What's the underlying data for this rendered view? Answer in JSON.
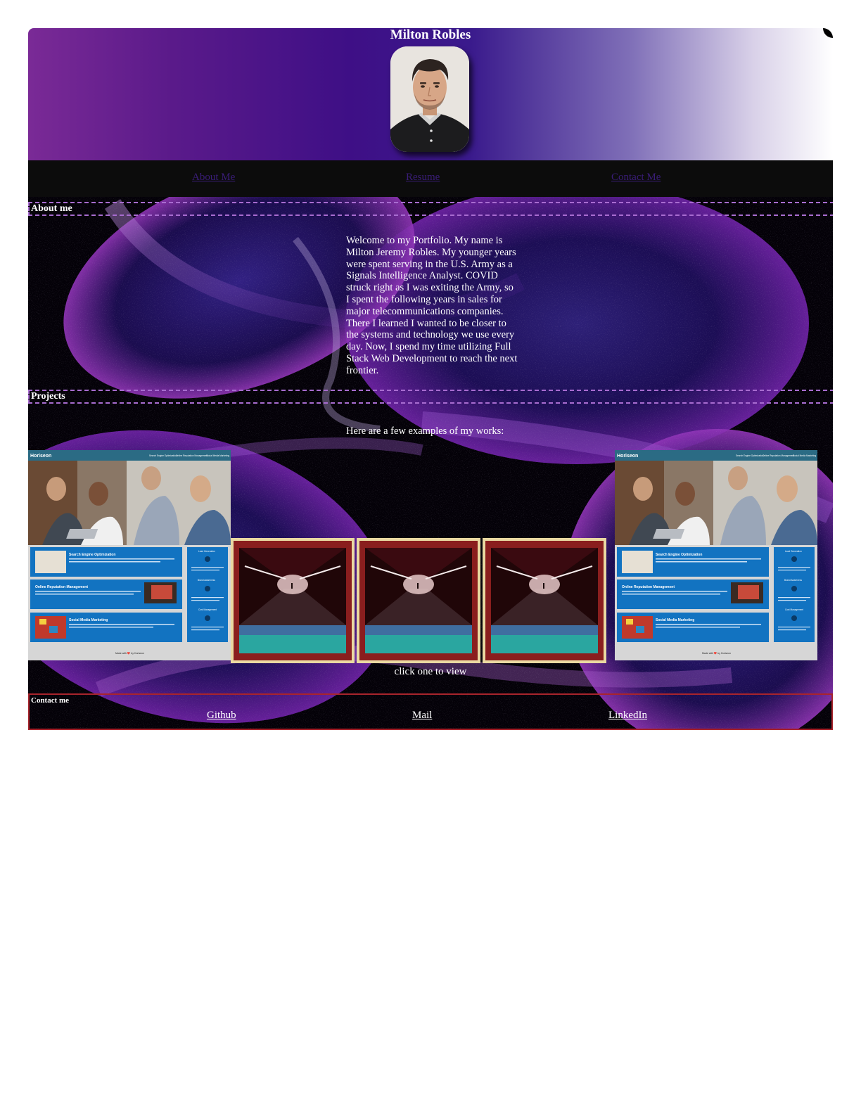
{
  "header": {
    "title": "Milton Robles",
    "avatar_icon": "profile-photo"
  },
  "nav": {
    "items": [
      {
        "label": "About Me"
      },
      {
        "label": "Resume"
      },
      {
        "label": "Contact Me"
      }
    ]
  },
  "about": {
    "heading": "About me",
    "body": "Welcome to my Portfolio. My name is Milton Jeremy Robles. My younger years were spent serving in the U.S. Army as a Signals Intelligence Analyst. COVID struck right as I was exiting the Army, so I spent the following years in sales for major telecommunications companies. There I learned I wanted to be closer to the systems and technology we use every day. Now, I spend my time utilizing Full Stack Web Development to reach the next frontier."
  },
  "projects": {
    "heading": "Projects",
    "intro": "Here are a few examples of my works:",
    "hint": "click one to view",
    "site_preview": {
      "brand": "Horiseon",
      "nav": [
        "Search Engine Optimization",
        "Online Reputation Management",
        "Social Media Marketing"
      ],
      "cards": [
        "Search Engine Optimization",
        "Online Reputation Management",
        "Social Media Marketing"
      ],
      "side": [
        "Lead Generation",
        "Brand Awareness",
        "Cost Management"
      ],
      "footer": "Made with ❤️ by Horiseon"
    }
  },
  "contact": {
    "heading": "Contact me",
    "links": [
      {
        "label": "Github"
      },
      {
        "label": "Mail"
      },
      {
        "label": "LinkedIn"
      }
    ]
  },
  "colors": {
    "header_purple": "#3e0f86",
    "nav_link": "#3a1d78",
    "section_dash": "#a86cd0",
    "contact_border": "#a8242c",
    "site_blue": "#1273c1",
    "site_header": "#2b6b84"
  }
}
